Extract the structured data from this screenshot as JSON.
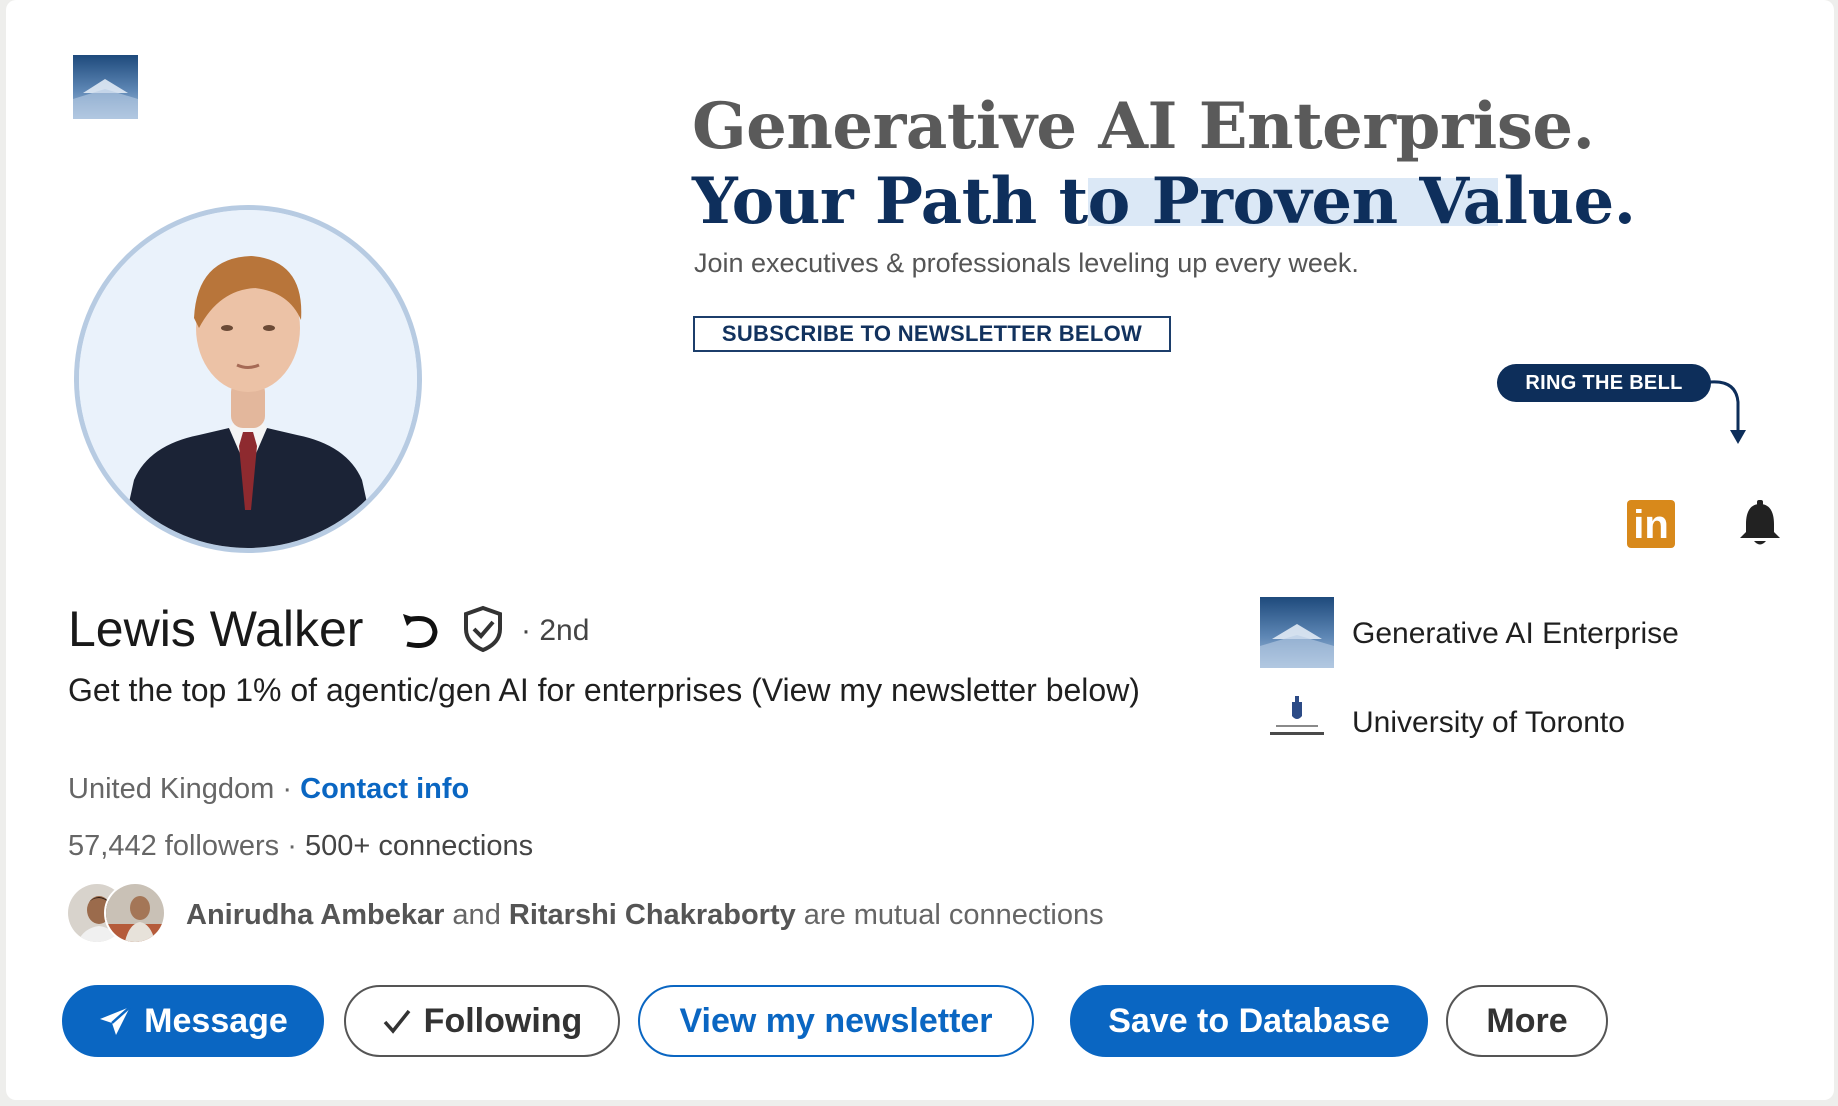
{
  "banner": {
    "title_line1": "Generative AI Enterprise.",
    "title_line2": "Your Path to Proven Value.",
    "subtitle": "Join executives & professionals leveling up every week.",
    "subscribe_label": "SUBSCRIBE TO NEWSLETTER BELOW",
    "ring_label": "RING THE BELL",
    "linkedin_glyph": "in",
    "accent_color": "#0e2f5c",
    "linkedin_color": "#d8891b"
  },
  "profile": {
    "name": "Lewis Walker",
    "degree": "· 2nd",
    "headline": "Get the top 1% of agentic/gen AI for enterprises (View my newsletter below)",
    "location": "United Kingdom",
    "separator": " · ",
    "contact_label": "Contact info",
    "followers": "57,442 followers",
    "connections_sep": " · ",
    "connections": "500+ connections",
    "mutual": {
      "name1": "Anirudha Ambekar",
      "and_text": " and ",
      "name2": "Ritarshi Chakraborty",
      "suffix": " are mutual connections"
    }
  },
  "affiliations": {
    "company": "Generative AI Enterprise",
    "university": "University of Toronto"
  },
  "actions": {
    "message": "Message",
    "following": "Following",
    "newsletter": "View my newsletter",
    "save": "Save to Database",
    "more": "More",
    "primary_color": "#0a66c2"
  }
}
